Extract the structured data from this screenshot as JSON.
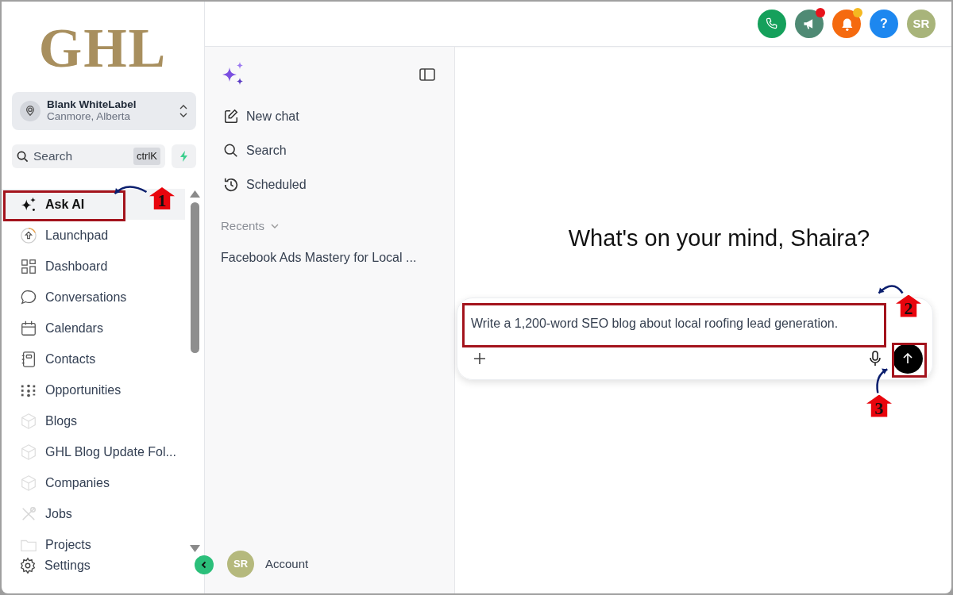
{
  "logo": {
    "text": "GHL"
  },
  "account_switcher": {
    "name": "Blank WhiteLabel",
    "location": "Canmore, Alberta"
  },
  "search": {
    "placeholder": "Search",
    "shortcut": "ctrlK"
  },
  "nav": [
    {
      "label": "Ask AI",
      "selected": true
    },
    {
      "label": "Launchpad",
      "selected": false
    },
    {
      "label": "Dashboard",
      "selected": false
    },
    {
      "label": "Conversations",
      "selected": false
    },
    {
      "label": "Calendars",
      "selected": false
    },
    {
      "label": "Contacts",
      "selected": false
    },
    {
      "label": "Opportunities",
      "selected": false
    },
    {
      "label": "Blogs",
      "selected": false
    },
    {
      "label": "GHL Blog Update Fol...",
      "selected": false
    },
    {
      "label": "Companies",
      "selected": false
    },
    {
      "label": "Jobs",
      "selected": false
    },
    {
      "label": "Projects",
      "selected": false
    }
  ],
  "settings": {
    "label": "Settings"
  },
  "topbar_buttons": [
    {
      "kind": "phone",
      "color": "#15a05b"
    },
    {
      "kind": "megaphone",
      "color": "#4f8a74",
      "dot": {
        "color": "#e8141c"
      }
    },
    {
      "kind": "bell",
      "color": "#f56a0f",
      "dot": {
        "color": "#f5b921"
      }
    },
    {
      "kind": "help",
      "text": "?",
      "color": "#1d87ef"
    },
    {
      "kind": "avatar",
      "text": "SR",
      "color": "#a8b47a"
    }
  ],
  "chat_sidebar": {
    "actions": [
      {
        "label": "New chat"
      },
      {
        "label": "Search"
      },
      {
        "label": "Scheduled"
      }
    ],
    "recents_label": "Recents",
    "recents_expanded": true,
    "recents": [
      {
        "title": "Facebook Ads Mastery for Local ..."
      }
    ],
    "account": {
      "initials": "SR",
      "label": "Account"
    }
  },
  "main": {
    "greeting": "What's on your mind, Shaira?",
    "prompt": {
      "value": "Write a 1,200-word SEO blog about local roofing lead generation."
    }
  },
  "annotations": [
    {
      "number": "1"
    },
    {
      "number": "2"
    },
    {
      "number": "3"
    }
  ]
}
